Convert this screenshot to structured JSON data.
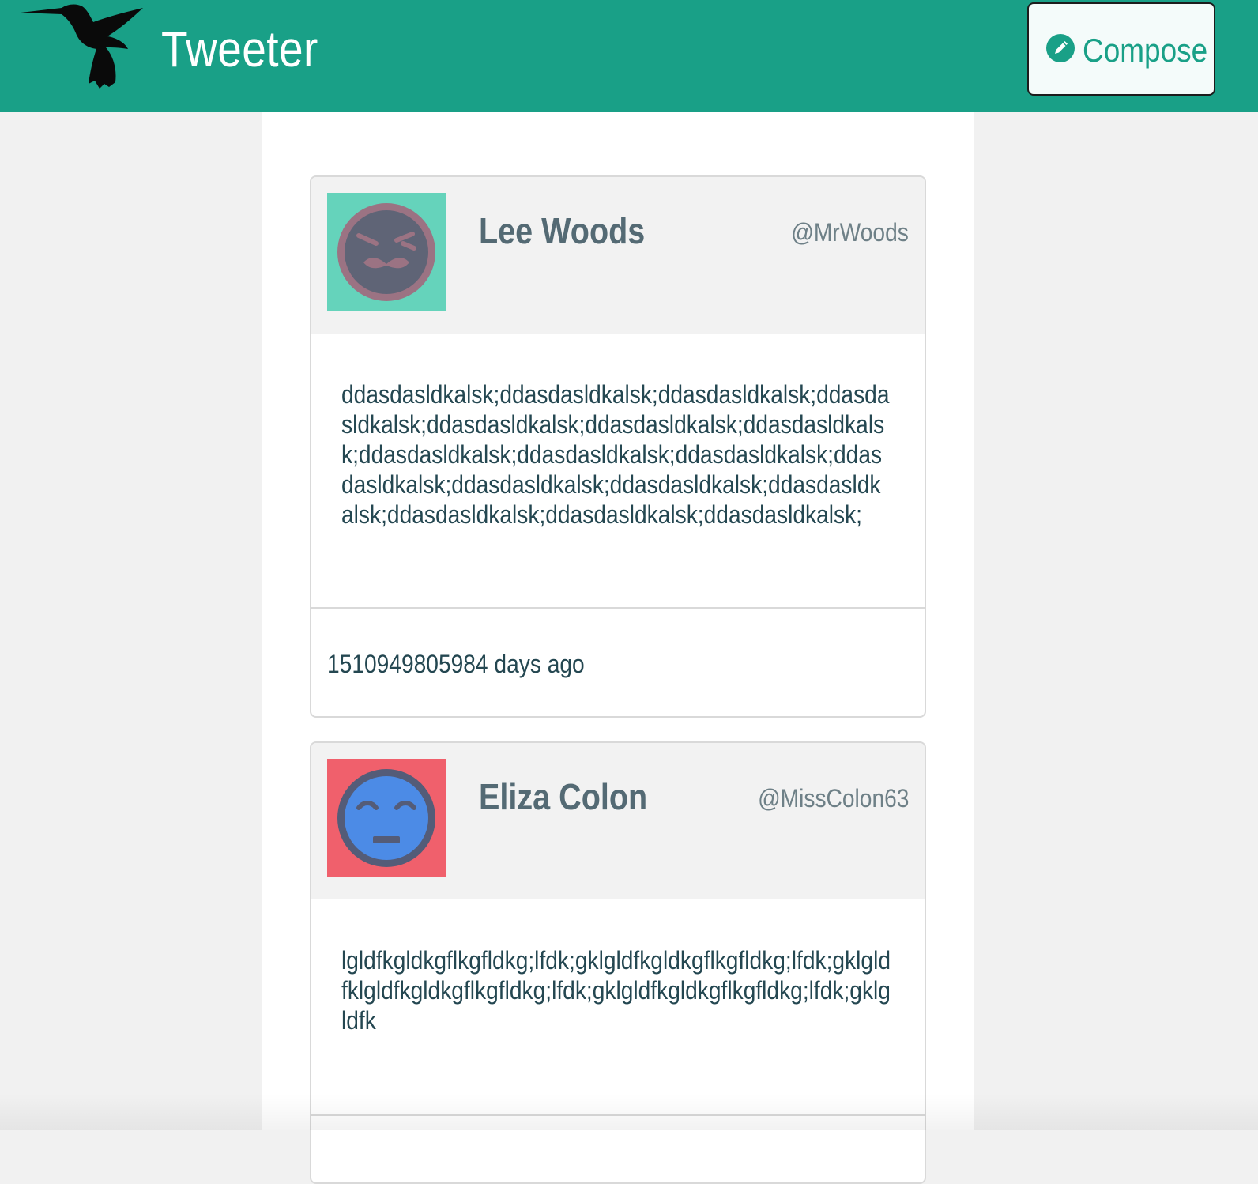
{
  "header": {
    "brand": "Tweeter",
    "logo_icon": "hummingbird-icon",
    "compose_label": "Compose",
    "compose_icon": "pencil-icon",
    "colors": {
      "bar": "#19a087",
      "compose_text": "#19a087"
    }
  },
  "tweets": [
    {
      "name": "Lee Woods",
      "handle": "@MrWoods",
      "avatar_icon": "mustache-face-avatar-icon",
      "avatar_bg": "#65d3bb",
      "content": "ddasdasldkalsk;ddasdasldkalsk;ddasdasldkalsk;ddasdasldkalsk;ddasdasldkalsk;ddasdasldkalsk;ddasdasldkalsk;ddasdasldkalsk;ddasdasldkalsk;ddasdasldkalsk;ddasdasldkalsk;ddasdasldkalsk;ddasdasldkalsk;ddasdasldkalsk;ddasdasldkalsk;ddasdasldkalsk;ddasdasldkalsk;",
      "timestamp": "1510949805984 days ago"
    },
    {
      "name": "Eliza Colon",
      "handle": "@MissColon63",
      "avatar_icon": "sleepy-face-avatar-icon",
      "avatar_bg": "#f0606c",
      "content": "lgldfkgldkgflkgfldkg;lfdk;gklgldfkgldkgflkgfldkg;lfdk;gklgldfklgldfkgldkgflkgfldkg;lfdk;gklgldfkgldkgflkgfldkg;lfdk;gklgldfk"
    }
  ]
}
